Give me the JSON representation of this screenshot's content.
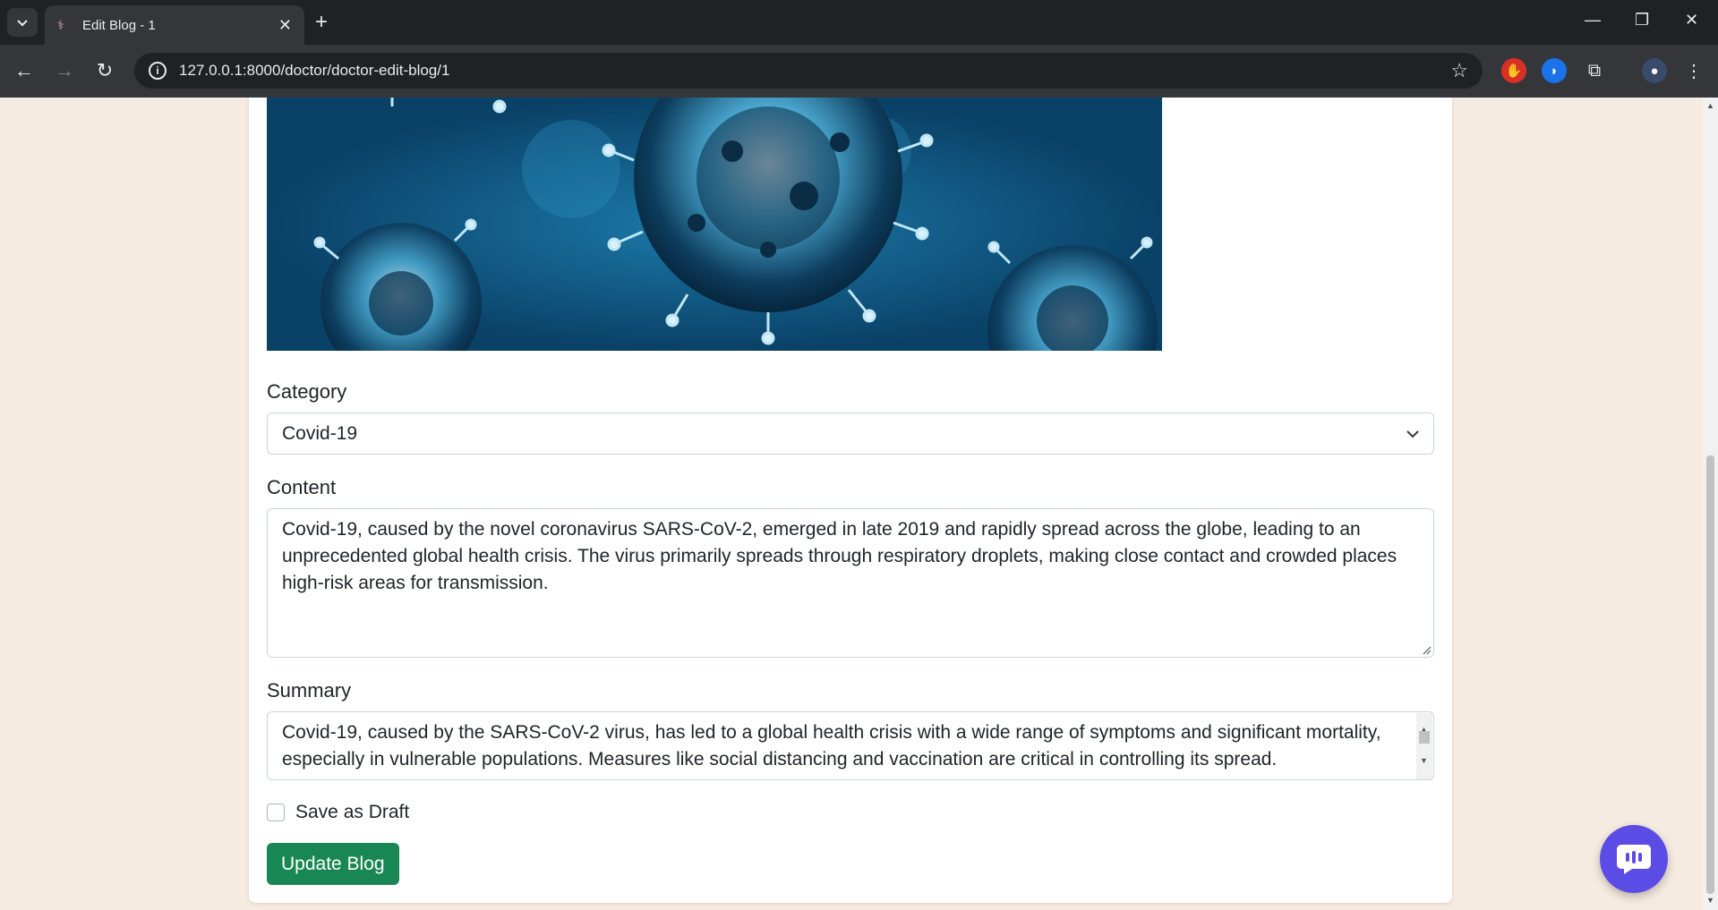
{
  "browser": {
    "tab_title": "Edit Blog - 1",
    "url": "127.0.0.1:8000/doctor/doctor-edit-blog/1"
  },
  "icons": {
    "tab_search": "chevron-down-icon",
    "favicon": "caduceus-icon",
    "tab_close": "close-icon",
    "new_tab": "plus-icon",
    "back": "arrow-left-icon",
    "forward": "arrow-right-icon",
    "reload": "reload-icon",
    "site_info": "info-icon",
    "bookmark": "star-icon",
    "chat": "chat-bubble-icon"
  },
  "form": {
    "category_label": "Category",
    "category_value": "Covid-19",
    "content_label": "Content",
    "content_value": "Covid-19, caused by the novel coronavirus SARS-CoV-2, emerged in late 2019 and rapidly spread across the globe, leading to an unprecedented global health crisis. The virus primarily spreads through respiratory droplets, making close contact and crowded places high-risk areas for transmission.",
    "summary_label": "Summary",
    "summary_value": "Covid-19, caused by the SARS-CoV-2 virus, has led to a global health crisis with a wide range of symptoms and significant mortality, especially in vulnerable populations. Measures like social distancing and vaccination are critical in controlling its spread.",
    "draft_label": "Save as Draft",
    "draft_checked": false,
    "submit_label": "Update Blog"
  },
  "colors": {
    "page_bg": "#f6ebe0",
    "submit_button": "#198754",
    "chat_button": "#5b4ce6"
  }
}
